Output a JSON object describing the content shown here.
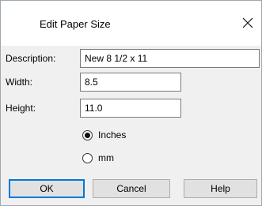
{
  "dialog": {
    "title": "Edit Paper Size",
    "close_glyph": "✕"
  },
  "form": {
    "description_label": "Description:",
    "description_value": "New 8 1/2 x 11",
    "width_label": "Width:",
    "width_value": "8.5",
    "height_label": "Height:",
    "height_value": "11.0"
  },
  "units": {
    "options": [
      {
        "label": "Inches",
        "selected": true
      },
      {
        "label": "mm",
        "selected": false
      }
    ]
  },
  "buttons": {
    "ok_label": "OK",
    "cancel_label": "Cancel",
    "help_label": "Help"
  },
  "colors": {
    "dialog_bg": "#f0f0f0",
    "titlebar_bg": "#ffffff",
    "default_button_border": "#0078d7"
  }
}
